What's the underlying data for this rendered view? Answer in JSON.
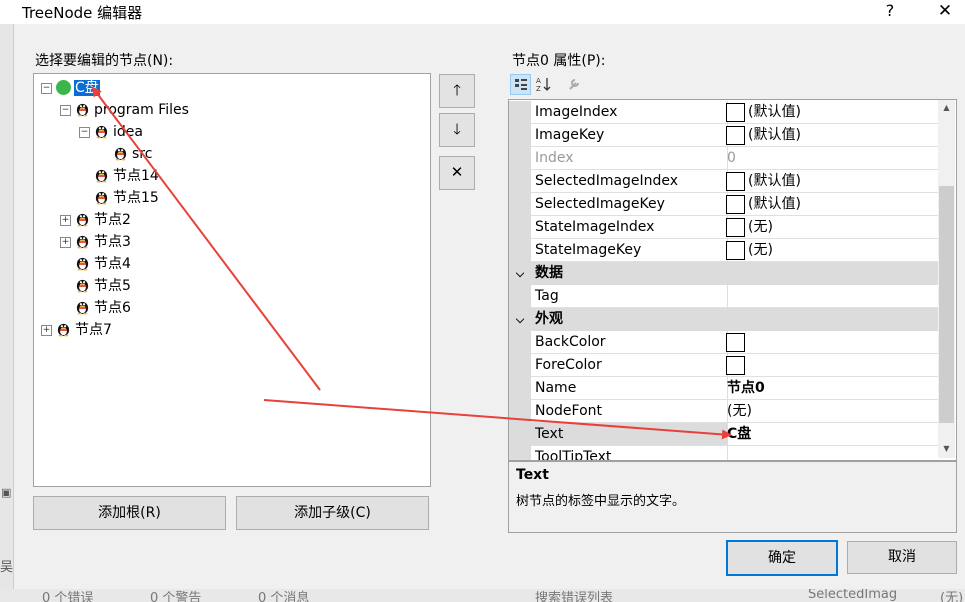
{
  "window": {
    "title": "TreeNode 编辑器",
    "help": "?",
    "close": "✕"
  },
  "tree": {
    "label": "选择要编辑的节点(N):",
    "nodes": [
      {
        "text": "C盘",
        "level": 0,
        "expander": "minus",
        "selected": true
      },
      {
        "text": "program Files",
        "level": 1,
        "expander": "minus"
      },
      {
        "text": "idea",
        "level": 2,
        "expander": "minus"
      },
      {
        "text": "src",
        "level": 3,
        "expander": "none"
      },
      {
        "text": "节点14",
        "level": 2,
        "expander": "none"
      },
      {
        "text": "节点15",
        "level": 2,
        "expander": "none"
      },
      {
        "text": "节点2",
        "level": 1,
        "expander": "plus"
      },
      {
        "text": "节点3",
        "level": 1,
        "expander": "plus"
      },
      {
        "text": "节点4",
        "level": 1,
        "expander": "none"
      },
      {
        "text": "节点5",
        "level": 1,
        "expander": "none"
      },
      {
        "text": "节点6",
        "level": 1,
        "expander": "none"
      },
      {
        "text": "节点7",
        "level": 0,
        "expander": "plus"
      }
    ]
  },
  "side_buttons": {
    "move_up": "🡑",
    "move_down": "🡓",
    "delete": "✕"
  },
  "bottom_buttons": {
    "add_root": "添加根(R)",
    "add_child": "添加子级(C)"
  },
  "properties": {
    "label": "节点0 属性(P):",
    "rows": [
      {
        "name": "ImageIndex",
        "value": "(默认值)",
        "swatch": true
      },
      {
        "name": "ImageKey",
        "value": "(默认值)",
        "swatch": true
      },
      {
        "name": "Index",
        "value": "0",
        "disabled": true
      },
      {
        "name": "SelectedImageIndex",
        "value": "(默认值)",
        "swatch": true
      },
      {
        "name": "SelectedImageKey",
        "value": "(默认值)",
        "swatch": true
      },
      {
        "name": "StateImageIndex",
        "value": "(无)",
        "swatch": true
      },
      {
        "name": "StateImageKey",
        "value": "(无)",
        "swatch": true
      },
      {
        "category": "数据"
      },
      {
        "name": "Tag",
        "value": ""
      },
      {
        "category": "外观"
      },
      {
        "name": "BackColor",
        "value": "",
        "swatch": true
      },
      {
        "name": "ForeColor",
        "value": "",
        "swatch": true
      },
      {
        "name": "Name",
        "value": "节点0",
        "bold": true
      },
      {
        "name": "NodeFont",
        "value": "(无)"
      },
      {
        "name": "Text",
        "value": "C盘",
        "bold": true,
        "selected": true
      },
      {
        "name": "ToolTipText",
        "value": ""
      }
    ]
  },
  "description": {
    "title": "Text",
    "text": "树节点的标签中显示的文字。"
  },
  "dialog_buttons": {
    "ok": "确定",
    "cancel": "取消"
  },
  "background_window": {
    "errors": "0 个错误",
    "warnings": "0 个警告",
    "messages": "0 个消息",
    "search": "搜索错误列表",
    "right_text": "SelectedImag",
    "right_value": "(无)",
    "left_char": "吴"
  },
  "colors": {
    "selection": "#0a6dd6",
    "arrow": "#e8413a",
    "ok_border": "#0078d7"
  }
}
